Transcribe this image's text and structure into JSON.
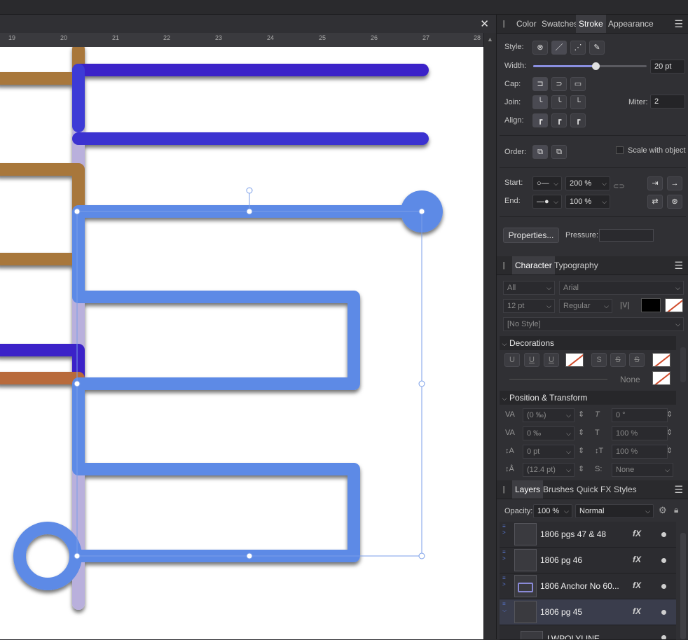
{
  "window": {
    "close_label": "✕"
  },
  "ruler": {
    "ticks": [
      "19",
      "20",
      "21",
      "22",
      "23",
      "24",
      "25",
      "26",
      "27",
      "28"
    ]
  },
  "panels": {
    "top_tabs": [
      {
        "label": "Color",
        "active": false
      },
      {
        "label": "Swatches",
        "active": false
      },
      {
        "label": "Stroke",
        "active": true
      },
      {
        "label": "Appearance",
        "active": false
      }
    ],
    "stroke": {
      "style_label": "Style:",
      "width_label": "Width:",
      "width_value": "20 pt",
      "width_fraction": 0.54,
      "cap_label": "Cap:",
      "join_label": "Join:",
      "miter_label": "Miter:",
      "miter_value": "2",
      "align_label": "Align:",
      "order_label": "Order:",
      "scale_label": "Scale with object",
      "start_label": "Start:",
      "start_percent": "200 %",
      "end_label": "End:",
      "end_percent": "100 %",
      "properties_button": "Properties...",
      "pressure_label": "Pressure:"
    },
    "char_tabs": [
      {
        "label": "Character",
        "active": true
      },
      {
        "label": "Typography",
        "active": false
      }
    ],
    "character": {
      "scope": "All",
      "font": "Arial",
      "size": "12 pt",
      "weight": "Regular",
      "style": "[No Style]",
      "decorations_title": "Decorations",
      "decoration_none": "None",
      "transform_title": "Position & Transform",
      "tracking": "(0 ‰)",
      "kerning": "0 ‰",
      "baseline": "0 pt",
      "leading": "(12.4 pt)",
      "skew": "0 °",
      "hscale": "100 %",
      "vscale": "100 %",
      "position": "None"
    },
    "layer_tabs": [
      {
        "label": "Layers",
        "active": true
      },
      {
        "label": "Brushes",
        "active": false
      },
      {
        "label": "Quick FX",
        "active": false
      },
      {
        "label": "Styles",
        "active": false
      }
    ],
    "layers": {
      "opacity_label": "Opacity:",
      "opacity_value": "100 %",
      "blend_mode": "Normal",
      "items": [
        {
          "name": "1806 pgs 47 & 48",
          "fx": "fX",
          "selected": false
        },
        {
          "name": "1806 pg 46",
          "fx": "fX",
          "selected": false
        },
        {
          "name": "1806 Anchor No 60...",
          "fx": "fX",
          "selected": false
        },
        {
          "name": "1806 pg 45",
          "fx": "fX",
          "selected": true
        },
        {
          "name": "LWPOLYLINE",
          "fx": "",
          "selected": false
        }
      ]
    }
  },
  "colors": {
    "gold": "#a8773b",
    "indigo": "#3a22c8",
    "blue": "#5d8ae6",
    "lavender": "#b9b0dc",
    "copper": "#b86a3a",
    "selection": "#7a9ee8"
  }
}
